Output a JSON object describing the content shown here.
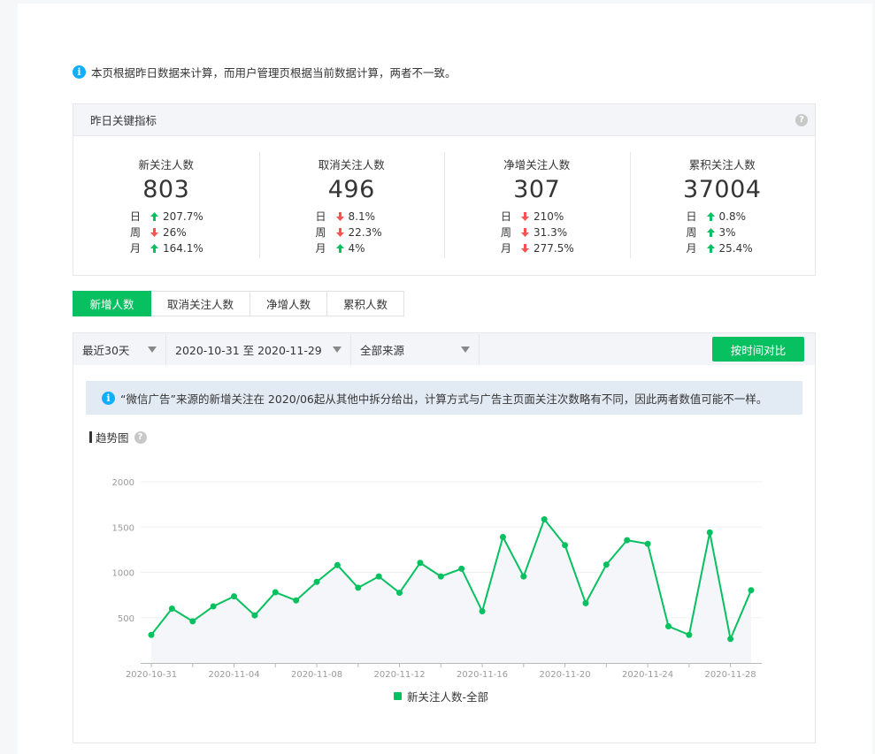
{
  "notice_top": "本页根据昨日数据来计算，而用户管理页根据当前数据计算，两者不一致。",
  "kpi": {
    "title": "昨日关键指标",
    "cards": [
      {
        "title": "新关注人数",
        "value": "803",
        "rows": [
          {
            "label": "日",
            "dir": "up",
            "value": "207.7%"
          },
          {
            "label": "周",
            "dir": "down",
            "value": "26%"
          },
          {
            "label": "月",
            "dir": "up",
            "value": "164.1%"
          }
        ]
      },
      {
        "title": "取消关注人数",
        "value": "496",
        "rows": [
          {
            "label": "日",
            "dir": "down",
            "value": "8.1%"
          },
          {
            "label": "周",
            "dir": "down",
            "value": "22.3%"
          },
          {
            "label": "月",
            "dir": "up",
            "value": "4%"
          }
        ]
      },
      {
        "title": "净增关注人数",
        "value": "307",
        "rows": [
          {
            "label": "日",
            "dir": "down",
            "value": "210%"
          },
          {
            "label": "周",
            "dir": "down",
            "value": "31.3%"
          },
          {
            "label": "月",
            "dir": "down",
            "value": "277.5%"
          }
        ]
      },
      {
        "title": "累积关注人数",
        "value": "37004",
        "rows": [
          {
            "label": "日",
            "dir": "up",
            "value": "0.8%"
          },
          {
            "label": "周",
            "dir": "up",
            "value": "3%"
          },
          {
            "label": "月",
            "dir": "up",
            "value": "25.4%"
          }
        ]
      }
    ]
  },
  "tabs": [
    {
      "label": "新增人数",
      "active": true
    },
    {
      "label": "取消关注人数",
      "active": false
    },
    {
      "label": "净增人数",
      "active": false
    },
    {
      "label": "累积人数",
      "active": false
    }
  ],
  "filters": {
    "period": "最近30天",
    "date_range": "2020-10-31 至 2020-11-29",
    "source": "全部来源",
    "compare_button": "按时间对比"
  },
  "notice_blue": "“微信广告”来源的新增关注在 2020/06起从其他中拆分给出，计算方式与广告主页面关注次数略有不同，因此两者数值可能不一样。",
  "trend_title": "趋势图",
  "colors": {
    "green": "#07c160",
    "red": "#fa5151",
    "info": "#10aeff"
  },
  "chart_data": {
    "type": "area",
    "ylim": [
      0,
      2000
    ],
    "yticks": [
      500,
      1000,
      1500,
      2000
    ],
    "x": [
      "2020-10-31",
      "2020-11-01",
      "2020-11-02",
      "2020-11-03",
      "2020-11-04",
      "2020-11-05",
      "2020-11-06",
      "2020-11-07",
      "2020-11-08",
      "2020-11-09",
      "2020-11-10",
      "2020-11-11",
      "2020-11-12",
      "2020-11-13",
      "2020-11-14",
      "2020-11-15",
      "2020-11-16",
      "2020-11-17",
      "2020-11-18",
      "2020-11-19",
      "2020-11-20",
      "2020-11-21",
      "2020-11-22",
      "2020-11-23",
      "2020-11-24",
      "2020-11-25",
      "2020-11-26",
      "2020-11-27",
      "2020-11-28",
      "2020-11-29"
    ],
    "xtick_labels": [
      "2020-10-31",
      "2020-11-04",
      "2020-11-08",
      "2020-11-12",
      "2020-11-16",
      "2020-11-20",
      "2020-11-24",
      "2020-11-28"
    ],
    "series": [
      {
        "name": "新关注人数-全部",
        "color": "#07c160",
        "values": [
          310,
          600,
          460,
          625,
          735,
          525,
          780,
          690,
          895,
          1080,
          830,
          955,
          775,
          1105,
          955,
          1040,
          570,
          1390,
          955,
          1585,
          1300,
          660,
          1085,
          1355,
          1315,
          405,
          310,
          1440,
          265,
          803
        ]
      }
    ]
  }
}
